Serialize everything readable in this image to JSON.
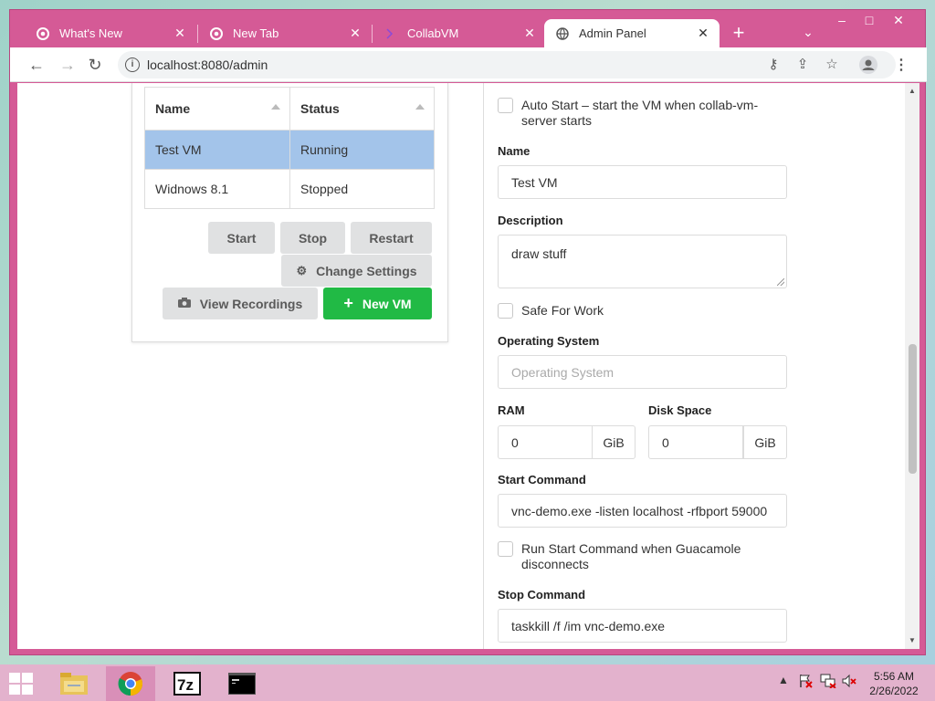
{
  "browser": {
    "tabs": [
      {
        "title": "What's New",
        "active": false
      },
      {
        "title": "New Tab",
        "active": false
      },
      {
        "title": "CollabVM",
        "active": false
      },
      {
        "title": "Admin Panel",
        "active": true
      }
    ],
    "url": "localhost:8080/admin",
    "accent": "#d55a96"
  },
  "vm_table": {
    "headers": [
      "Name",
      "Status"
    ],
    "rows": [
      {
        "name": "Test VM",
        "status": "Running",
        "selected": true
      },
      {
        "name": "Widnows 8.1",
        "status": "Stopped",
        "selected": false
      }
    ]
  },
  "actions": {
    "start": "Start",
    "stop": "Stop",
    "restart": "Restart",
    "change_settings": "Change Settings",
    "view_recordings": "View Recordings",
    "new_vm": "New VM"
  },
  "form": {
    "auto_start": "Auto Start – start the VM when collab-vm-server starts",
    "name_label": "Name",
    "name_value": "Test VM",
    "description_label": "Description",
    "description_value": "draw stuff",
    "safe_for_work": "Safe For Work",
    "os_label": "Operating System",
    "os_placeholder": "Operating System",
    "ram_label": "RAM",
    "ram_value": "0",
    "ram_unit": "GiB",
    "disk_label": "Disk Space",
    "disk_value": "0",
    "disk_unit": "GiB",
    "start_cmd_label": "Start Command",
    "start_cmd_value": "vnc-demo.exe -listen localhost -rfbport 59000",
    "run_start_on_disconnect": "Run Start Command when Guacamole disconnects",
    "stop_cmd_label": "Stop Command",
    "stop_cmd_value": "taskkill /f /im vnc-demo.exe"
  },
  "taskbar": {
    "time": "5:56 AM",
    "date": "2/26/2022"
  }
}
